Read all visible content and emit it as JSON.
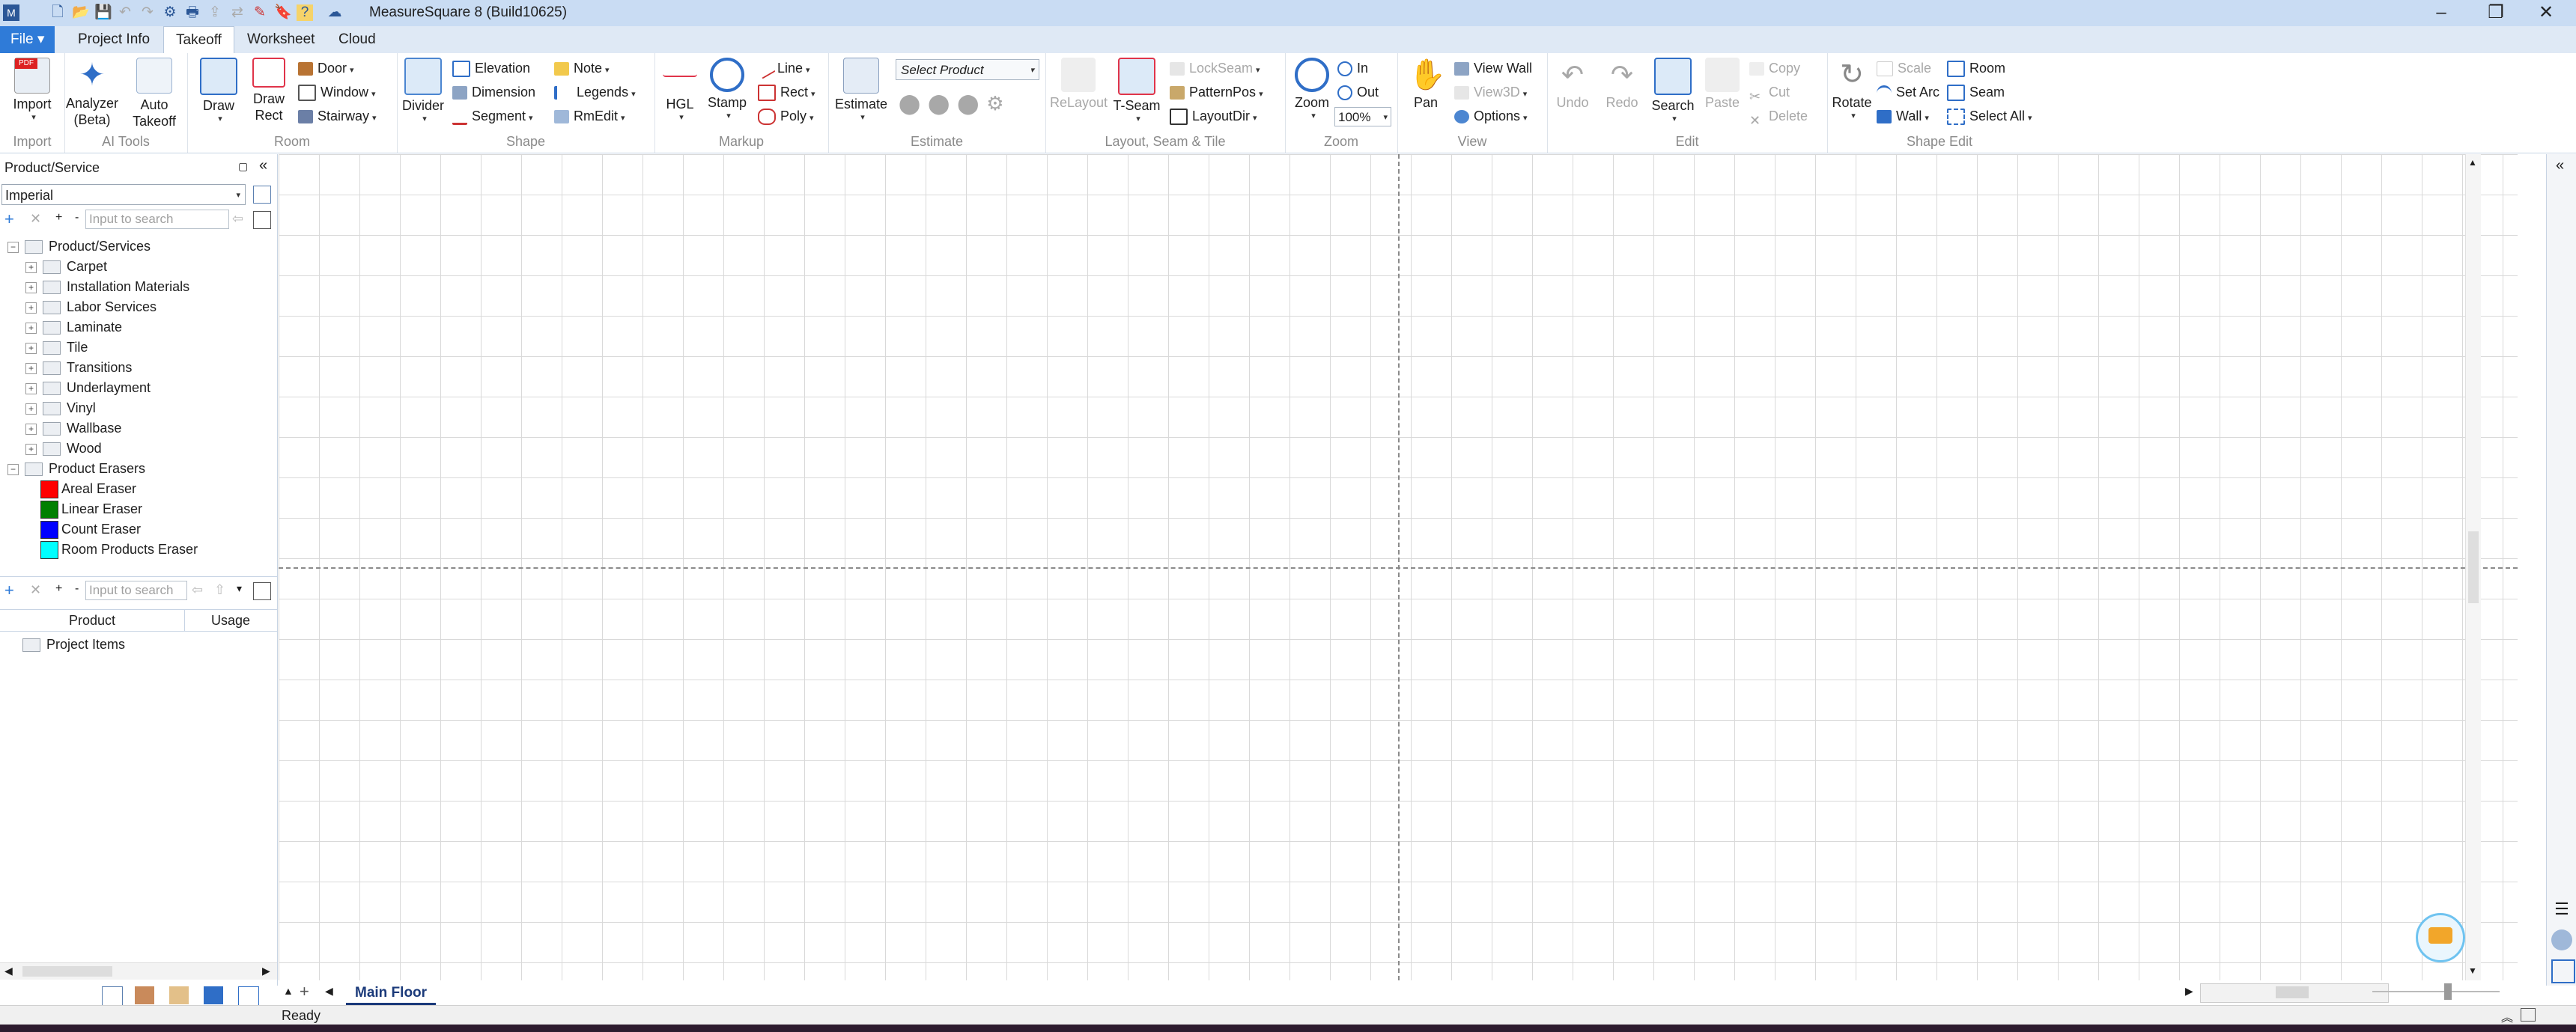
{
  "window": {
    "title": "MeasureSquare 8 (Build10625)"
  },
  "tabs": [
    "File",
    "Project Info",
    "Takeoff",
    "Worksheet",
    "Cloud"
  ],
  "ribbon": {
    "import": {
      "label": "Import",
      "group": "Import"
    },
    "ai_tools": {
      "analyzer": "Analyzer (Beta)",
      "auto_takeoff": "Auto Takeoff",
      "group": "AI Tools"
    },
    "room": {
      "draw": "Draw",
      "draw_rect": "Draw Rect",
      "door": "Door",
      "window": "Window",
      "stairway": "Stairway",
      "group": "Room"
    },
    "shape": {
      "divider": "Divider",
      "elevation": "Elevation",
      "dimension": "Dimension",
      "segment": "Segment",
      "note": "Note",
      "legends": "Legends",
      "rmedit": "RmEdit",
      "group": "Shape"
    },
    "markup": {
      "hgl": "HGL",
      "stamp": "Stamp",
      "line": "Line",
      "rect": "Rect",
      "poly": "Poly",
      "group": "Markup"
    },
    "estimate": {
      "estimate": "Estimate",
      "select_product": "Select Product",
      "group": "Estimate"
    },
    "layout": {
      "relayout": "ReLayout",
      "tseam": "T-Seam",
      "lockseam": "LockSeam",
      "patternpos": "PatternPos",
      "layoutdir": "LayoutDir",
      "group": "Layout, Seam & Tile"
    },
    "zoom": {
      "zoom": "Zoom",
      "in": "In",
      "out": "Out",
      "level": "100%",
      "group": "Zoom"
    },
    "view": {
      "pan": "Pan",
      "view_wall": "View Wall",
      "view3d": "View3D",
      "options": "Options",
      "group": "View"
    },
    "edit": {
      "undo": "Undo",
      "redo": "Redo",
      "search": "Search",
      "paste": "Paste",
      "copy": "Copy",
      "cut": "Cut",
      "delete": "Delete",
      "group": "Edit"
    },
    "shape_edit": {
      "rotate": "Rotate",
      "scale": "Scale",
      "set_arc": "Set Arc",
      "wall": "Wall",
      "room": "Room",
      "seam": "Seam",
      "select_all": "Select All",
      "group": "Shape Edit"
    }
  },
  "left_panel": {
    "title": "Product/Service",
    "unit_system": "Imperial",
    "search_placeholder": "Input to search",
    "tree_root": "Product/Services",
    "categories": [
      "Carpet",
      "Installation Materials",
      "Labor Services",
      "Laminate",
      "Tile",
      "Transitions",
      "Underlayment",
      "Vinyl",
      "Wallbase",
      "Wood"
    ],
    "erasers_root": "Product Erasers",
    "erasers": [
      {
        "label": "Areal Eraser",
        "color": "#ff0000"
      },
      {
        "label": "Linear Eraser",
        "color": "#008000"
      },
      {
        "label": "Count Eraser",
        "color": "#0000ff"
      },
      {
        "label": "Room Products Eraser",
        "color": "#00ffff"
      }
    ],
    "lower_search_placeholder": "Input to search",
    "columns": [
      "Product",
      "Usage"
    ],
    "project_items": "Project Items"
  },
  "page_tabs": {
    "active": "Main Floor"
  },
  "status": {
    "text": "Ready"
  }
}
